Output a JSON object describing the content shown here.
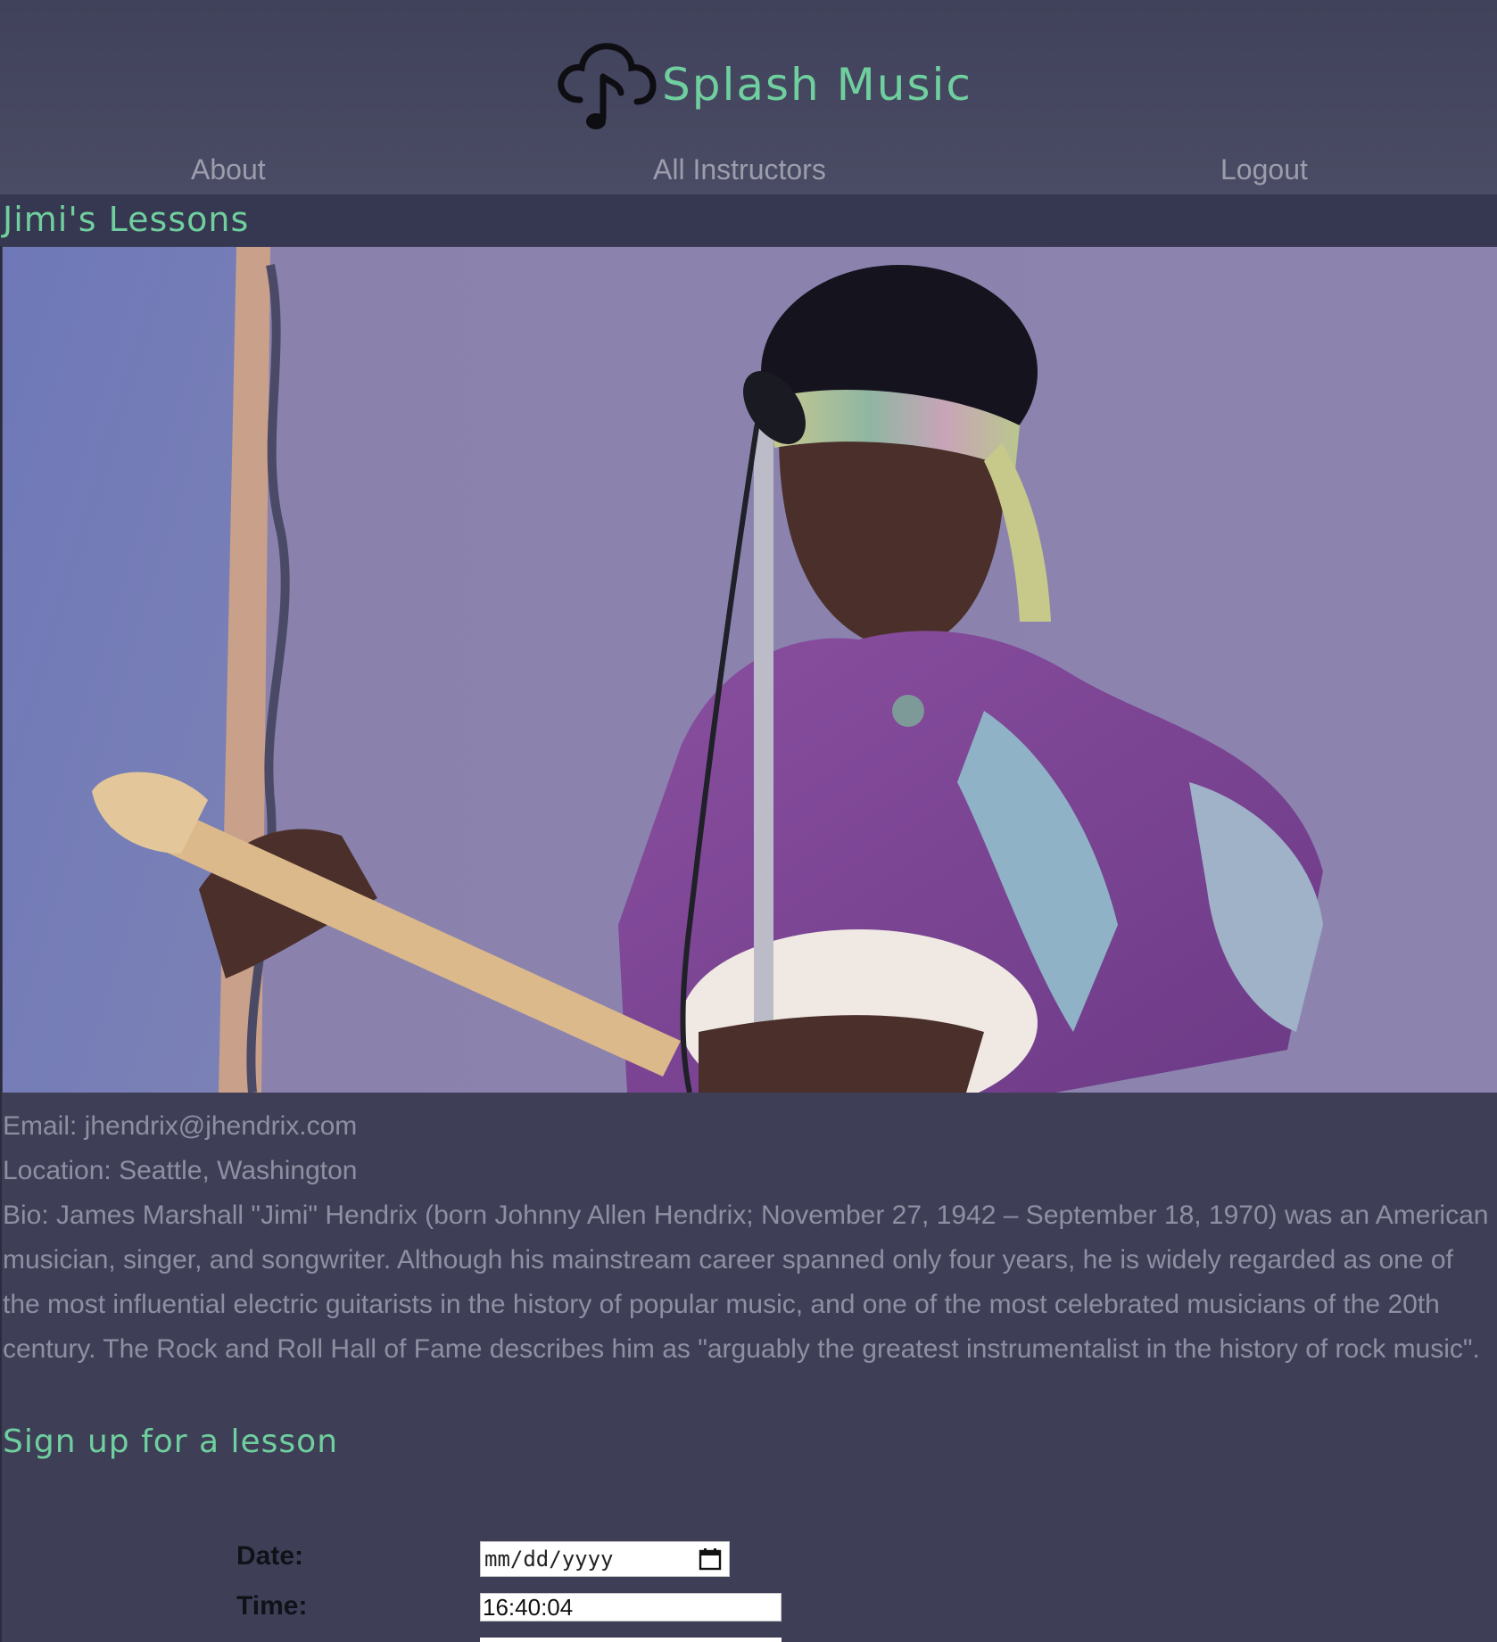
{
  "brand": {
    "name": "Splash Music",
    "logo_icon": "cloud-music-note-icon",
    "name_color": "#6fcf9e"
  },
  "nav": {
    "about": "About",
    "all_instructors": "All Instructors",
    "logout": "Logout"
  },
  "page": {
    "title": "Jimi's Lessons"
  },
  "instructor": {
    "photo_subject": "guitarist-photo",
    "email": "Email: jhendrix@jhendrix.com",
    "location": "Location: Seattle, Washington",
    "bio": "Bio: James Marshall \"Jimi\" Hendrix (born Johnny Allen Hendrix; November 27, 1942 – September 18, 1970) was an American musician, singer, and songwriter. Although his mainstream career spanned only four years, he is widely regarded as one of the most influential electric guitarists in the history of popular music, and one of the most celebrated musicians of the 20th century. The Rock and Roll Hall of Fame describes him as \"arguably the greatest instrumentalist in the history of rock music\"."
  },
  "signup": {
    "title": "Sign up for a lesson",
    "date_label": "Date:",
    "date_placeholder": "mm/dd/yyyy",
    "time_label": "Time:",
    "time_value": "16:40:04"
  },
  "colors": {
    "background": "#3e3f57",
    "accent": "#6fcf9e",
    "muted_text": "#8e8fa1"
  }
}
